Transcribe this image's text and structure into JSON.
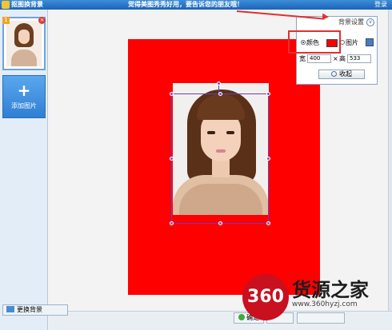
{
  "titlebar": {
    "title": "抠图换背景",
    "promo": "觉得美图秀秀好用，要告诉您的朋友哦！",
    "login": "登录"
  },
  "left_panel": {
    "thumb_number": "1",
    "add_label": "添加图片",
    "change_bg_label": "更换背景"
  },
  "popup": {
    "title": "背景设置",
    "color_label": "颜色",
    "image_label": "图片",
    "width_label": "宽",
    "width_value": "400",
    "height_label": "高",
    "height_value": "533",
    "collapse_label": "收起",
    "swatch_color": "#ff0000"
  },
  "watermark": {
    "badge": "360",
    "title": "货源之家",
    "url": "www.360hyzj.com"
  },
  "bottom": {
    "ok_label": "确定"
  }
}
